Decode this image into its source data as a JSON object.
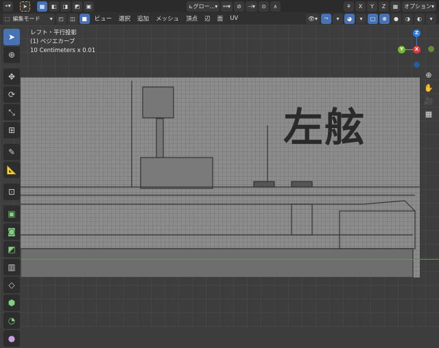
{
  "header1": {
    "transform_orientation": "グロー...",
    "options": "オプション",
    "axes": [
      "X",
      "Y",
      "Z"
    ]
  },
  "header2": {
    "mode": "編集モード",
    "menus": [
      "ビュー",
      "選択",
      "追加",
      "メッシュ",
      "頂点",
      "辺",
      "面",
      "UV"
    ]
  },
  "info": {
    "view": "レフト・平行投影",
    "object": "(1) ベジエカーブ",
    "scale": "10 Centimeters x 0.01"
  },
  "gizmo": {
    "z": "Z",
    "y": "Y",
    "x": "X"
  },
  "image_text": "左舷",
  "colors": {
    "accent": "#4772b3",
    "x": "#e3363f",
    "y": "#76b82a",
    "z": "#2e7fe0"
  }
}
